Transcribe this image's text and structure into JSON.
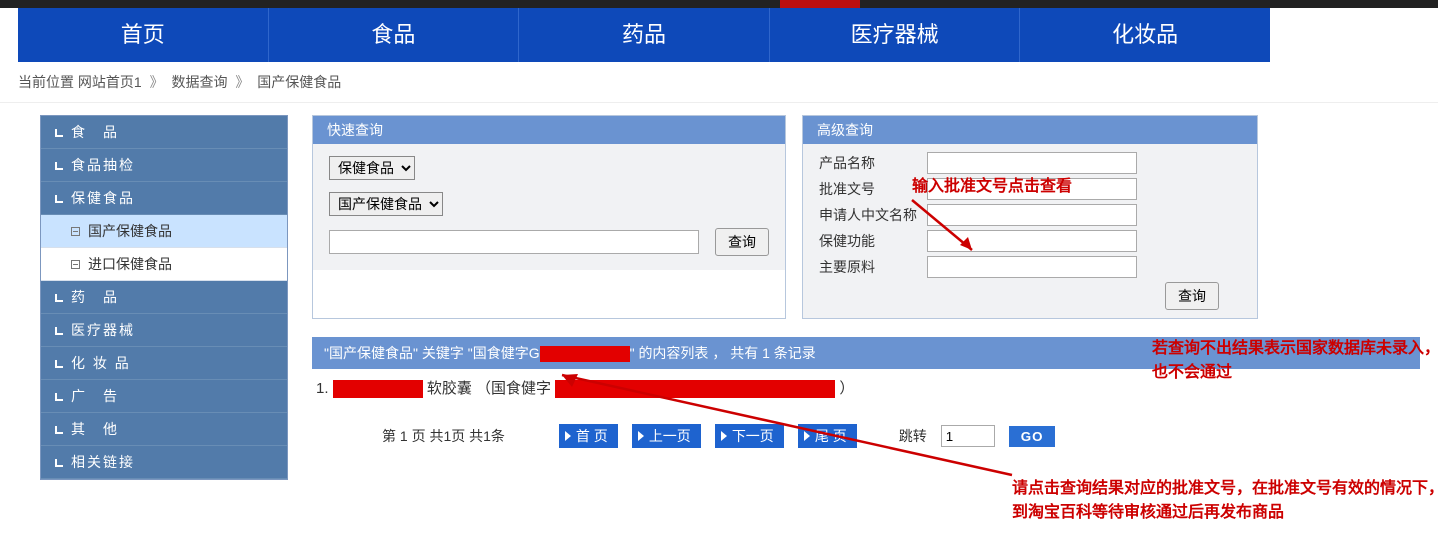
{
  "nav": [
    "首页",
    "食品",
    "药品",
    "医疗器械",
    "化妆品"
  ],
  "breadcrumb": {
    "label": "当前位置",
    "path": [
      "网站首页1",
      "数据查询",
      "国产保健食品"
    ]
  },
  "sidebar": {
    "cats": [
      {
        "label": "食　品",
        "type": "cat"
      },
      {
        "label": "食品抽检",
        "type": "cat"
      },
      {
        "label": "保健食品",
        "type": "cat"
      },
      {
        "label": "国产保健食品",
        "type": "sub",
        "active": true
      },
      {
        "label": "进口保健食品",
        "type": "sub"
      },
      {
        "label": "药　品",
        "type": "cat"
      },
      {
        "label": "医疗器械",
        "type": "cat"
      },
      {
        "label": "化 妆 品",
        "type": "cat"
      },
      {
        "label": "广　告",
        "type": "cat"
      },
      {
        "label": "其　他",
        "type": "cat"
      },
      {
        "label": "相关链接",
        "type": "cat"
      }
    ]
  },
  "quick": {
    "title": "快速查询",
    "sel1": [
      "保健食品"
    ],
    "sel2": [
      "国产保健食品"
    ],
    "btn": "查询"
  },
  "adv": {
    "title": "高级查询",
    "fields": [
      "产品名称",
      "批准文号",
      "申请人中文名称",
      "保健功能",
      "主要原料"
    ],
    "btn": "查询"
  },
  "results": {
    "bar_prefix": "\"国产保健食品\" 关键字 \"国食健字G",
    "bar_suffix": "\" 的内容列表 ， 共有 1 条记录",
    "item_prefix": "1.",
    "item_mid": "软胶囊 （国食健字",
    "item_end": "）"
  },
  "pager": {
    "info": "第 1 页 共1页 共1条",
    "first": "首 页",
    "prev": "上一页",
    "next": "下一页",
    "last": "尾 页",
    "jump": "跳转",
    "jump_val": "1",
    "go": "GO"
  },
  "anno": {
    "a1": "输入批准文号点击查看",
    "a2": "若查询不出结果表示国家数据库未录入，则去淘宝百科提交也不会通过",
    "a3": "请点击查询结果对应的批准文号，在批准文号有效的情况下，根据查询结果提交到淘宝百科等待审核通过后再发布商品"
  }
}
